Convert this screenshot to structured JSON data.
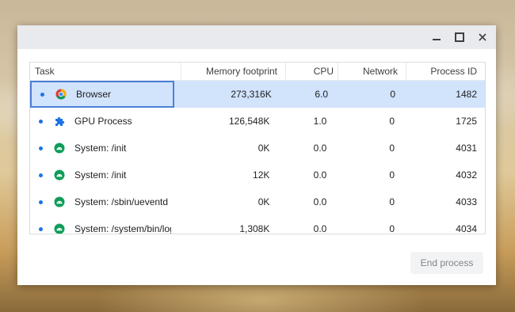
{
  "window": {
    "controls": {
      "minimize": "minimize-icon",
      "maximize": "maximize-icon",
      "close": "close-icon"
    }
  },
  "table": {
    "headers": {
      "task": "Task",
      "memory": "Memory footprint",
      "cpu": "CPU",
      "network": "Network",
      "pid": "Process ID"
    },
    "rows": [
      {
        "icon": "chrome-icon",
        "task": "Browser",
        "memory": "273,316K",
        "cpu": "6.0",
        "network": "0",
        "pid": "1482"
      },
      {
        "icon": "puzzle-icon",
        "task": "GPU Process",
        "memory": "126,548K",
        "cpu": "1.0",
        "network": "0",
        "pid": "1725"
      },
      {
        "icon": "android-icon",
        "task": "System: /init",
        "memory": "0K",
        "cpu": "0.0",
        "network": "0",
        "pid": "4031"
      },
      {
        "icon": "android-icon",
        "task": "System: /init",
        "memory": "12K",
        "cpu": "0.0",
        "network": "0",
        "pid": "4032"
      },
      {
        "icon": "android-icon",
        "task": "System: /sbin/ueventd",
        "memory": "0K",
        "cpu": "0.0",
        "network": "0",
        "pid": "4033"
      },
      {
        "icon": "android-icon",
        "task": "System: /system/bin/log",
        "memory": "1,308K",
        "cpu": "0.0",
        "network": "0",
        "pid": "4034"
      }
    ],
    "selected_index": 0
  },
  "footer": {
    "end_process_label": "End process"
  },
  "colors": {
    "accent": "#1a73e8",
    "selection": "#d2e3fc",
    "android_green": "#0f9d58"
  }
}
